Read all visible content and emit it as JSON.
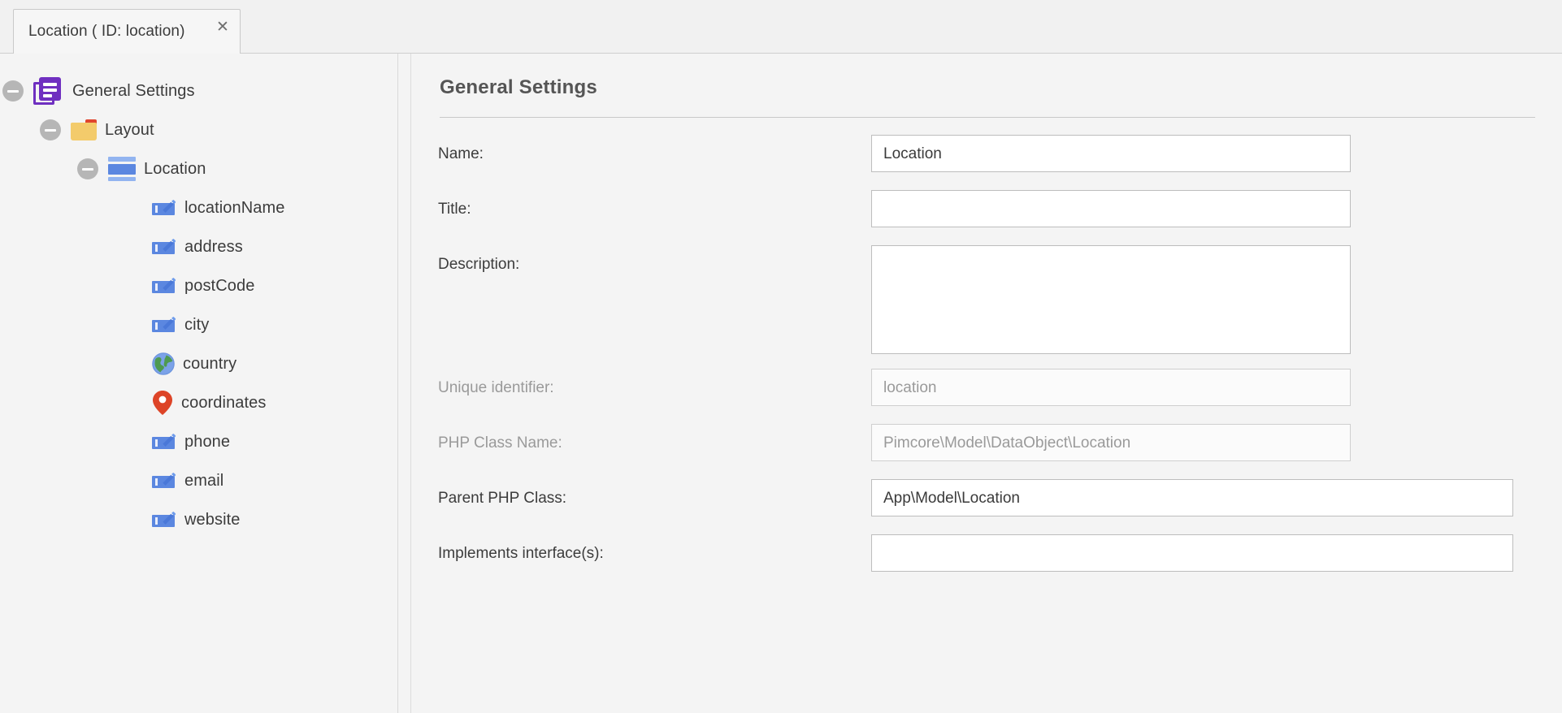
{
  "tab": {
    "title": "Location ( ID: location)",
    "close_icon": "close-icon",
    "close_glyph": "✕"
  },
  "tree": {
    "items": [
      {
        "label": "General Settings",
        "icon": "documents-stack-icon",
        "depth": 0,
        "expander": "collapse-toggle"
      },
      {
        "label": "Layout",
        "icon": "folder-icon",
        "depth": 1,
        "expander": "collapse-toggle"
      },
      {
        "label": "Location",
        "icon": "panel-layout-icon",
        "depth": 2,
        "expander": "collapse-toggle"
      },
      {
        "label": "locationName",
        "icon": "input-text-icon",
        "depth": 3,
        "expander": "none"
      },
      {
        "label": "address",
        "icon": "input-text-icon",
        "depth": 3,
        "expander": "none"
      },
      {
        "label": "postCode",
        "icon": "input-text-icon",
        "depth": 3,
        "expander": "none"
      },
      {
        "label": "city",
        "icon": "input-text-icon",
        "depth": 3,
        "expander": "none"
      },
      {
        "label": "country",
        "icon": "globe-icon",
        "depth": 3,
        "expander": "none"
      },
      {
        "label": "coordinates",
        "icon": "map-pin-icon",
        "depth": 3,
        "expander": "none"
      },
      {
        "label": "phone",
        "icon": "input-text-icon",
        "depth": 3,
        "expander": "none"
      },
      {
        "label": "email",
        "icon": "input-text-icon",
        "depth": 3,
        "expander": "none"
      },
      {
        "label": "website",
        "icon": "input-text-icon",
        "depth": 3,
        "expander": "none"
      }
    ]
  },
  "form": {
    "title": "General Settings",
    "fields": [
      {
        "label": "Name:",
        "value": "Location",
        "placeholder": "",
        "disabled": false,
        "multiline": false
      },
      {
        "label": "Title:",
        "value": "",
        "placeholder": "",
        "disabled": false,
        "multiline": false
      },
      {
        "label": "Description:",
        "value": "",
        "placeholder": "",
        "disabled": false,
        "multiline": true
      },
      {
        "label": "Unique identifier:",
        "value": "location",
        "placeholder": "",
        "disabled": true,
        "multiline": false
      },
      {
        "label": "PHP Class Name:",
        "value": "Pimcore\\Model\\DataObject\\Location",
        "placeholder": "",
        "disabled": true,
        "multiline": false
      },
      {
        "label": "Parent PHP Class:",
        "value": "App\\Model\\Location",
        "placeholder": "",
        "disabled": false,
        "multiline": false
      },
      {
        "label": "Implements interface(s):",
        "value": "",
        "placeholder": "",
        "disabled": false,
        "multiline": false
      }
    ]
  },
  "colors": {
    "accent_purple": "#6f2fc0",
    "accent_blue": "#5b87e0",
    "folder_yellow": "#f3cb6b",
    "pin_red": "#e0452e",
    "background": "#f4f4f4"
  }
}
